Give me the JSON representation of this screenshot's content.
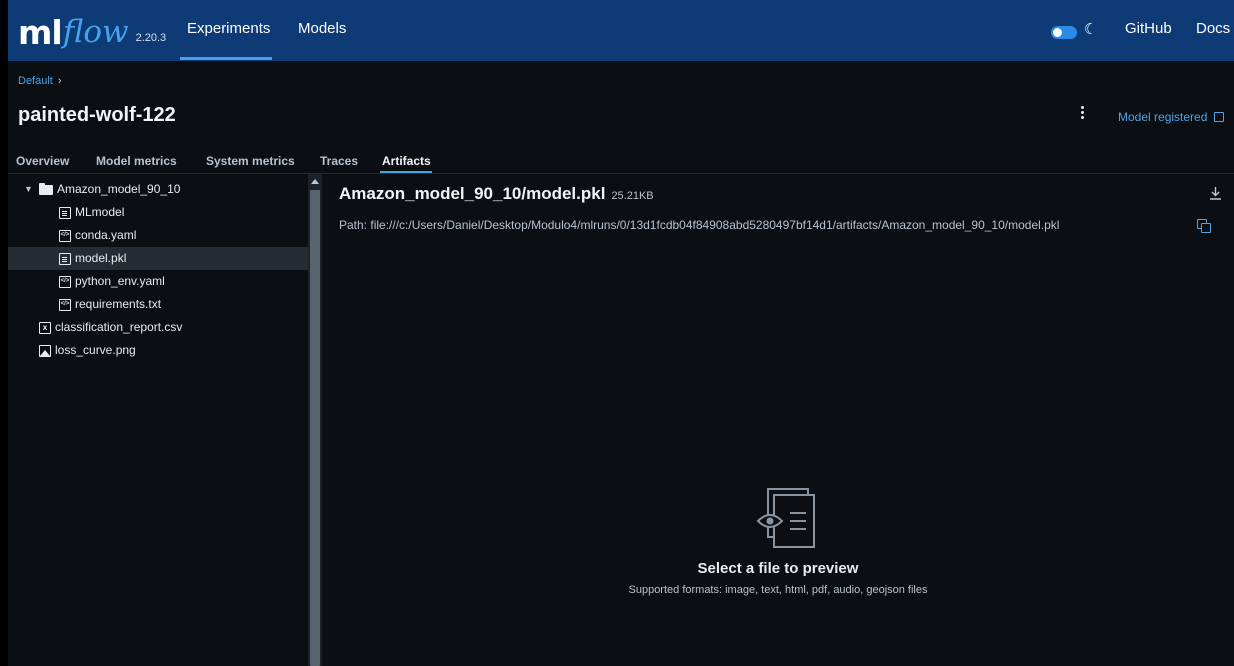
{
  "app": {
    "logo_ml": "ml",
    "logo_flow": "flow",
    "version": "2.20.3",
    "nav": {
      "experiments": "Experiments",
      "models": "Models",
      "github": "GitHub",
      "docs": "Docs"
    },
    "accent_color": "#43a4ec",
    "topbar_color": "#0e3a75"
  },
  "header": {
    "breadcrumb": "Default",
    "breadcrumb_separator": "›",
    "run_name": "painted-wolf-122",
    "model_registered": "Model registered"
  },
  "tabs": [
    {
      "label": "Overview",
      "active": false
    },
    {
      "label": "Model metrics",
      "active": false
    },
    {
      "label": "System metrics",
      "active": false
    },
    {
      "label": "Traces",
      "active": false
    },
    {
      "label": "Artifacts",
      "active": true
    }
  ],
  "tree": [
    {
      "name": "Amazon_model_90_10",
      "type": "folder",
      "icon": "folder-icon",
      "expanded": true,
      "selected": false
    },
    {
      "name": "MLmodel",
      "type": "file",
      "icon": "file-icon",
      "selected": false
    },
    {
      "name": "conda.yaml",
      "type": "code",
      "icon": "code-file-icon",
      "selected": false
    },
    {
      "name": "model.pkl",
      "type": "file",
      "icon": "file-icon",
      "selected": true
    },
    {
      "name": "python_env.yaml",
      "type": "code",
      "icon": "code-file-icon",
      "selected": false
    },
    {
      "name": "requirements.txt",
      "type": "code",
      "icon": "code-file-icon",
      "selected": false
    },
    {
      "name": "classification_report.csv",
      "type": "spreadsheet",
      "icon": "spreadsheet-file-icon",
      "selected": false
    },
    {
      "name": "loss_curve.png",
      "type": "image",
      "icon": "image-file-icon",
      "selected": false
    }
  ],
  "detail": {
    "file_title": "Amazon_model_90_10/model.pkl",
    "file_size": "25.21KB",
    "path": "Path: file:///c:/Users/Daniel/Desktop/Modulo4/mlruns/0/13d1fcdb04f84908abd5280497bf14d1/artifacts/Amazon_model_90_10/model.pkl",
    "empty_title": "Select a file to preview",
    "empty_subtitle": "Supported formats: image, text, html, pdf, audio, geojson files"
  }
}
